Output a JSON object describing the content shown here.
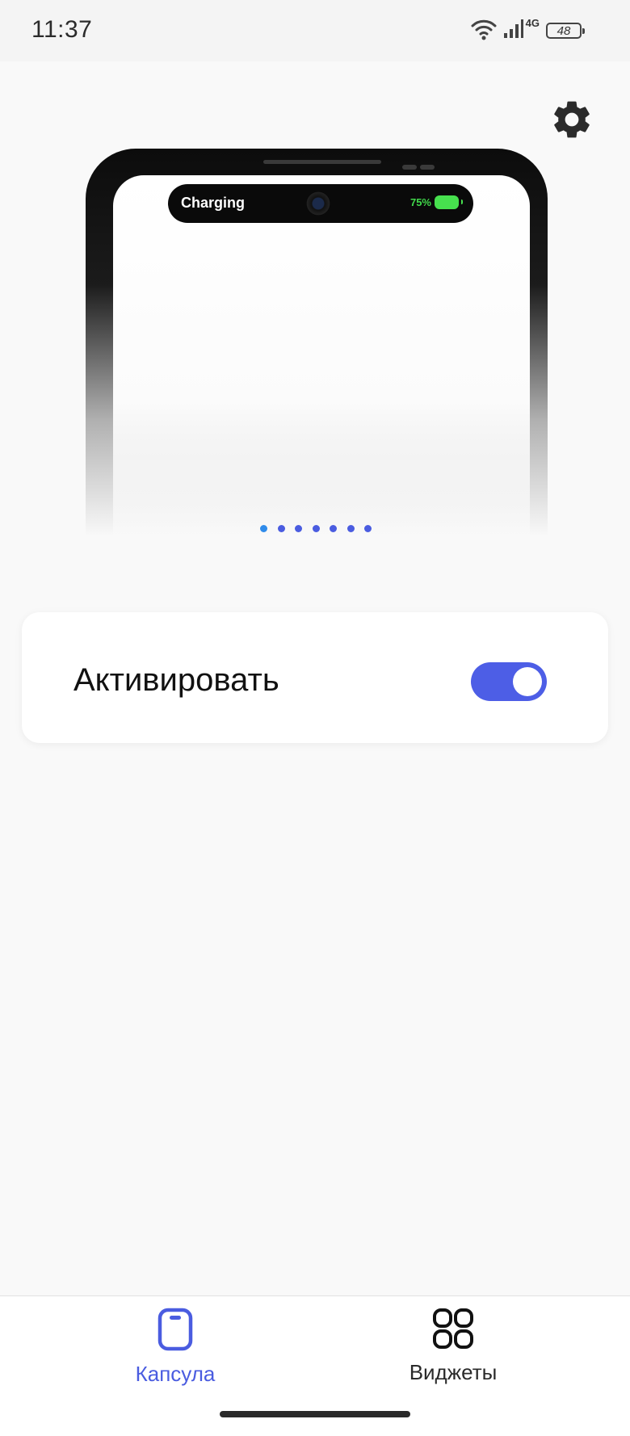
{
  "status_bar": {
    "time": "11:37",
    "network": "4G",
    "battery": "48"
  },
  "preview": {
    "island_text": "Charging",
    "battery_percent": "75%",
    "page_count": 7,
    "active_page": 0
  },
  "activate": {
    "label": "Активировать",
    "enabled": true
  },
  "nav": {
    "items": [
      {
        "label": "Капсула",
        "icon": "capsule-icon",
        "active": true
      },
      {
        "label": "Виджеты",
        "icon": "widgets-grid-icon",
        "active": false
      }
    ]
  },
  "colors": {
    "accent": "#4a5ce0",
    "toggle": "#4d5ee6",
    "battery_green": "#47e04e",
    "background": "#f9f9f9"
  }
}
